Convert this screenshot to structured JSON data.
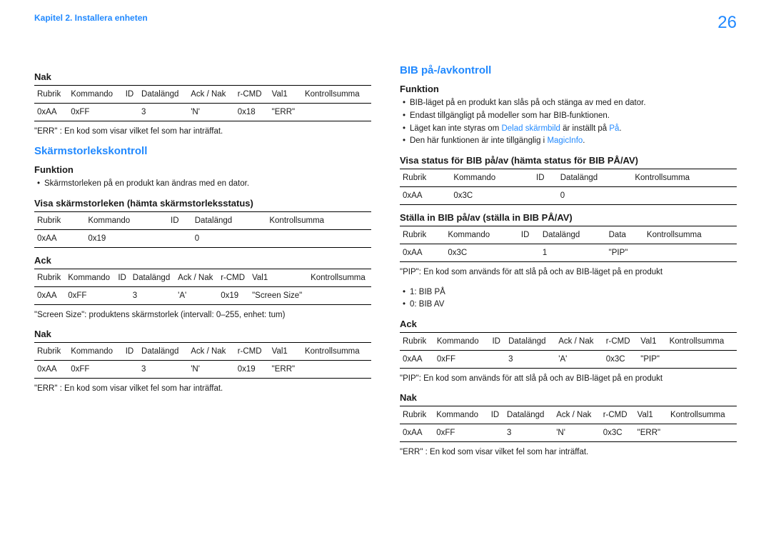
{
  "header": {
    "breadcrumb": "Kapitel 2. Installera enheten",
    "page_number": "26"
  },
  "left": {
    "nak1": {
      "title": "Nak",
      "headers": [
        "Rubrik",
        "Kommando",
        "ID",
        "Datalängd",
        "Ack / Nak",
        "r-CMD",
        "Val1",
        "Kontrollsumma"
      ],
      "row": [
        "0xAA",
        "0xFF",
        "",
        "3",
        "'N'",
        "0x18",
        "\"ERR\"",
        ""
      ],
      "note": "\"ERR\" : En kod som visar vilket fel som har inträffat."
    },
    "section_title": "Skärmstorlekskontroll",
    "funktion": {
      "title": "Funktion",
      "bullets": [
        "Skärmstorleken på en produkt kan ändras med en dator."
      ]
    },
    "visa": {
      "title": "Visa skärmstorleken (hämta skärmstorleksstatus)",
      "headers": [
        "Rubrik",
        "Kommando",
        "ID",
        "Datalängd",
        "Kontrollsumma"
      ],
      "row": [
        "0xAA",
        "0x19",
        "",
        "0",
        ""
      ]
    },
    "ack": {
      "title": "Ack",
      "headers": [
        "Rubrik",
        "Kommando",
        "ID",
        "Datalängd",
        "Ack / Nak",
        "r-CMD",
        "Val1",
        "Kontrollsumma"
      ],
      "row": [
        "0xAA",
        "0xFF",
        "",
        "3",
        "'A'",
        "0x19",
        "\"Screen Size\"",
        ""
      ],
      "note": "\"Screen Size\": produktens skärmstorlek (intervall: 0–255, enhet: tum)"
    },
    "nak2": {
      "title": "Nak",
      "headers": [
        "Rubrik",
        "Kommando",
        "ID",
        "Datalängd",
        "Ack / Nak",
        "r-CMD",
        "Val1",
        "Kontrollsumma"
      ],
      "row": [
        "0xAA",
        "0xFF",
        "",
        "3",
        "'N'",
        "0x19",
        "\"ERR\"",
        ""
      ],
      "note": "\"ERR\" : En kod som visar vilket fel som har inträffat."
    }
  },
  "right": {
    "section_title": "BIB på-/avkontroll",
    "funktion": {
      "title": "Funktion",
      "bullets_pre": [
        "BIB-läget på en produkt kan slås på och stänga av med en dator.",
        "Endast tillgängligt på modeller som har BIB-funktionen."
      ],
      "bullet3_parts": [
        "Läget kan inte styras om ",
        "Delad skärmbild",
        " är inställt på ",
        "På",
        "."
      ],
      "bullet4_parts": [
        "Den här funktionen är inte tillgänglig i ",
        "MagicInfo",
        "."
      ]
    },
    "visa": {
      "title": "Visa status för BIB på/av (hämta status för BIB PÅ/AV)",
      "headers": [
        "Rubrik",
        "Kommando",
        "ID",
        "Datalängd",
        "Kontrollsumma"
      ],
      "row": [
        "0xAA",
        "0x3C",
        "",
        "0",
        ""
      ]
    },
    "stalla": {
      "title": "Ställa in BIB på/av (ställa in BIB PÅ/AV)",
      "headers": [
        "Rubrik",
        "Kommando",
        "ID",
        "Datalängd",
        "Data",
        "Kontrollsumma"
      ],
      "row": [
        "0xAA",
        "0x3C",
        "",
        "1",
        "\"PIP\"",
        ""
      ],
      "note": "\"PIP\": En kod som används för att slå på och av BIB-läget på en produkt",
      "opts": [
        "1: BIB PÅ",
        "0: BIB AV"
      ]
    },
    "ack": {
      "title": "Ack",
      "headers": [
        "Rubrik",
        "Kommando",
        "ID",
        "Datalängd",
        "Ack / Nak",
        "r-CMD",
        "Val1",
        "Kontrollsumma"
      ],
      "row": [
        "0xAA",
        "0xFF",
        "",
        "3",
        "'A'",
        "0x3C",
        "\"PIP\"",
        ""
      ],
      "note": "\"PIP\": En kod som används för att slå på och av BIB-läget på en produkt"
    },
    "nak": {
      "title": "Nak",
      "headers": [
        "Rubrik",
        "Kommando",
        "ID",
        "Datalängd",
        "Ack / Nak",
        "r-CMD",
        "Val1",
        "Kontrollsumma"
      ],
      "row": [
        "0xAA",
        "0xFF",
        "",
        "3",
        "'N'",
        "0x3C",
        "\"ERR\"",
        ""
      ],
      "note": "\"ERR\" : En kod som visar vilket fel som har inträffat."
    }
  }
}
